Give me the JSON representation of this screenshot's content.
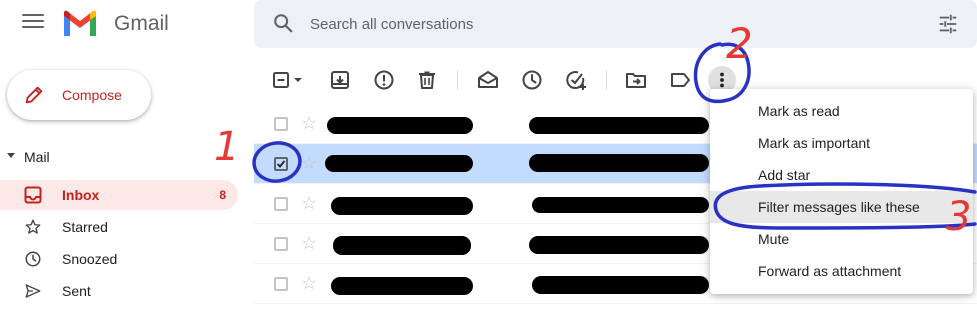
{
  "app": {
    "name": "Gmail",
    "brand_colors": [
      "#4285f4",
      "#ea4335",
      "#fbbc04",
      "#34a853",
      "#c5221f"
    ]
  },
  "search": {
    "placeholder": "Search all conversations",
    "value": ""
  },
  "sidebar": {
    "compose_label": "Compose",
    "section_label": "Mail",
    "items": [
      {
        "label": "Inbox",
        "count": "8",
        "icon": "inbox-icon",
        "active": true
      },
      {
        "label": "Starred",
        "count": "",
        "icon": "star-icon",
        "active": false
      },
      {
        "label": "Snoozed",
        "count": "",
        "icon": "clock-icon",
        "active": false
      },
      {
        "label": "Sent",
        "count": "",
        "icon": "send-icon",
        "active": false
      }
    ]
  },
  "toolbar": {
    "icons": [
      "select-checkbox-icon",
      "select-dropdown-icon",
      "archive-icon",
      "report-spam-icon",
      "delete-icon",
      "mark-as-read-icon",
      "snooze-icon",
      "add-to-tasks-icon",
      "move-to-icon",
      "label-icon",
      "more-options-icon"
    ]
  },
  "mail_rows": [
    {
      "selected": false,
      "starred": false
    },
    {
      "selected": true,
      "starred": false
    },
    {
      "selected": false,
      "starred": false
    },
    {
      "selected": false,
      "starred": false
    },
    {
      "selected": false,
      "starred": false
    }
  ],
  "context_menu": {
    "items": [
      {
        "label": "Mark as read"
      },
      {
        "label": "Mark as important"
      },
      {
        "label": "Add star"
      },
      {
        "label": "Filter messages like these",
        "highlighted": true
      },
      {
        "label": "Mute"
      },
      {
        "label": "Forward as attachment"
      }
    ]
  },
  "annotations": {
    "step_1": "1",
    "step_2": "2",
    "step_3": "3",
    "ink_color": "#2a32c4",
    "number_color": "#e53935"
  }
}
